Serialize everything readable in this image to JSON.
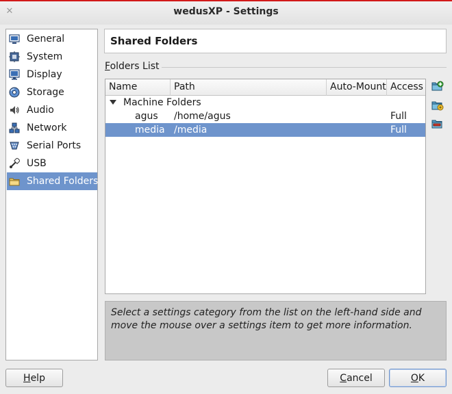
{
  "window": {
    "title": "wedusXP - Settings",
    "close_glyph": "✕"
  },
  "sidebar": {
    "items": [
      {
        "label": "General",
        "icon": "general-icon"
      },
      {
        "label": "System",
        "icon": "system-icon"
      },
      {
        "label": "Display",
        "icon": "display-icon"
      },
      {
        "label": "Storage",
        "icon": "storage-icon"
      },
      {
        "label": "Audio",
        "icon": "audio-icon"
      },
      {
        "label": "Network",
        "icon": "network-icon"
      },
      {
        "label": "Serial Ports",
        "icon": "serial-ports-icon"
      },
      {
        "label": "USB",
        "icon": "usb-icon"
      },
      {
        "label": "Shared Folders",
        "icon": "shared-folders-icon",
        "selected": true
      }
    ]
  },
  "page": {
    "title": "Shared Folders",
    "folders_list_label": "Folders List",
    "columns": [
      "Name",
      "Path",
      "Auto-Mount",
      "Access"
    ],
    "group": "Machine Folders",
    "rows": [
      {
        "name": "agus",
        "path": "/home/agus",
        "auto_mount": "",
        "access": "Full"
      },
      {
        "name": "media",
        "path": "/media",
        "auto_mount": "",
        "access": "Full",
        "selected": true
      }
    ],
    "tools": [
      "add-folder-icon",
      "edit-folder-icon",
      "remove-folder-icon"
    ],
    "info_text": "Select a settings category from the list on the left-hand side and move the mouse over a settings item to get more information."
  },
  "buttons": {
    "help": {
      "pre": "",
      "mn": "H",
      "post": "elp"
    },
    "cancel": {
      "pre": "",
      "mn": "C",
      "post": "ancel"
    },
    "ok": {
      "pre": "",
      "mn": "O",
      "post": "K"
    }
  },
  "colors": {
    "selection": "#6e94cc",
    "title_accent": "#d21a1a",
    "info_bg": "#c8c8c8"
  }
}
